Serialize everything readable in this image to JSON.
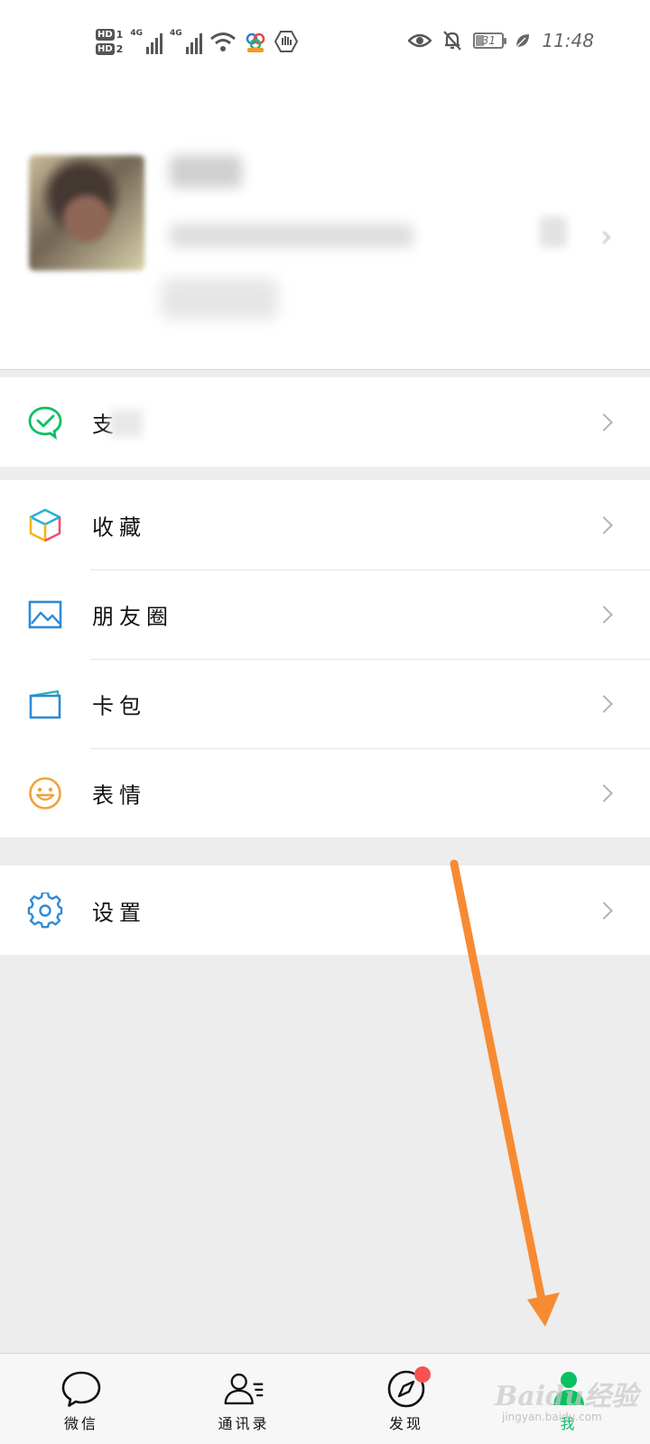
{
  "status_bar": {
    "hd1": "HD",
    "hd1_index": "1",
    "hd2": "HD",
    "hd2_index": "2",
    "network1": "4G",
    "network2": "4G",
    "battery": "31",
    "time": "11:48"
  },
  "menu": {
    "pay": {
      "label": "支",
      "icon": "wechat-pay-icon"
    },
    "favorites": {
      "label": "收藏",
      "icon": "favorites-cube-icon"
    },
    "moments": {
      "label": "朋友圈",
      "icon": "moments-picture-icon"
    },
    "cards": {
      "label": "卡包",
      "icon": "card-wallet-icon"
    },
    "stickers": {
      "label": "表情",
      "icon": "smiley-icon"
    },
    "settings": {
      "label": "设置",
      "icon": "gear-icon"
    }
  },
  "tabbar": {
    "chats": "微信",
    "contacts": "通讯录",
    "discover": "发现",
    "me": "我"
  },
  "watermark": {
    "text": "Baidu经验",
    "sub": "jingyan.baidu.com"
  },
  "colors": {
    "accent_green": "#07c160",
    "badge_red": "#fa5151",
    "arrow_orange": "#f78b33"
  }
}
